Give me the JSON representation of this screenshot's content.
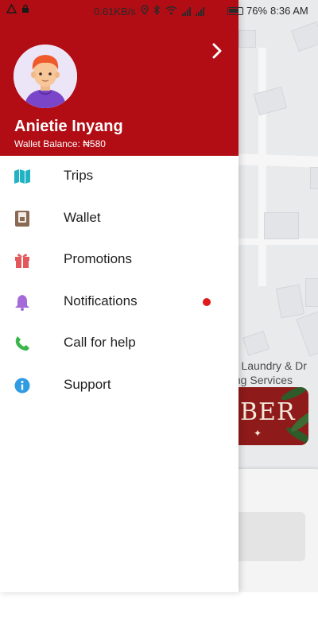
{
  "status_bar": {
    "network_speed": "0.61KB/s",
    "battery_percent": "76%",
    "time": "8:36 AM"
  },
  "drawer": {
    "header": {
      "user_name": "Anietie Inyang",
      "wallet_balance": "Wallet Balance: ₦580",
      "background_color": "#b20d14"
    },
    "menu": [
      {
        "label": "Trips",
        "icon": "map-icon",
        "color": "#1fb3c4"
      },
      {
        "label": "Wallet",
        "icon": "wallet-icon",
        "color": "#8a6a55"
      },
      {
        "label": "Promotions",
        "icon": "gift-icon",
        "color": "#e4575a"
      },
      {
        "label": "Notifications",
        "icon": "bell-icon",
        "color": "#a46ad9",
        "badge_color": "#e01b1b"
      },
      {
        "label": "Call for help",
        "icon": "phone-icon",
        "color": "#39b54a"
      },
      {
        "label": "Support",
        "icon": "info-icon",
        "color": "#2f9be3"
      }
    ]
  },
  "map": {
    "poi_label_line1": "oo Laundry & Dr",
    "poi_label_line2": "ning Services",
    "banner_text": "BER"
  }
}
